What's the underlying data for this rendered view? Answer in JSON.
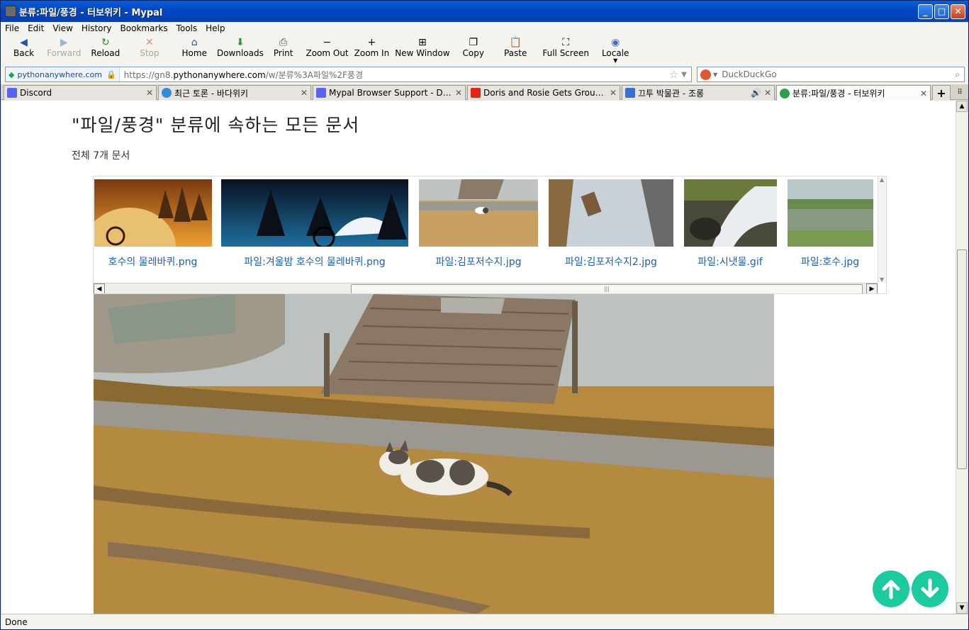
{
  "window": {
    "title": "분류:파일/풍경 - 터보위키 - Mypal"
  },
  "menu": [
    "File",
    "Edit",
    "View",
    "History",
    "Bookmarks",
    "Tools",
    "Help"
  ],
  "toolbar": [
    {
      "label": "Back",
      "icon": "back-arrow-icon",
      "enabled": true
    },
    {
      "label": "Forward",
      "icon": "forward-arrow-icon",
      "enabled": false
    },
    {
      "label": "Reload",
      "icon": "reload-icon",
      "enabled": true
    },
    {
      "label": "Stop",
      "icon": "stop-icon",
      "enabled": false
    },
    {
      "label": "Home",
      "icon": "home-icon",
      "enabled": true
    },
    {
      "label": "Downloads",
      "icon": "download-icon",
      "enabled": true
    },
    {
      "label": "Print",
      "icon": "printer-icon",
      "enabled": true
    },
    {
      "label": "Zoom Out",
      "icon": "minus-icon",
      "enabled": true
    },
    {
      "label": "Zoom In",
      "icon": "plus-icon",
      "enabled": true
    },
    {
      "label": "New Window",
      "icon": "new-window-icon",
      "enabled": true
    },
    {
      "label": "Copy",
      "icon": "copy-icon",
      "enabled": true
    },
    {
      "label": "Paste",
      "icon": "paste-icon",
      "enabled": true
    },
    {
      "label": "Full Screen",
      "icon": "fullscreen-icon",
      "enabled": true
    },
    {
      "label": "Locale",
      "icon": "globe-icon",
      "enabled": true
    }
  ],
  "address": {
    "site": "pythonanywhere.com",
    "url_prefix": "https://gn8.",
    "url_domain": "pythonanywhere.com",
    "url_path": "/w/분류%3A파일%2F풍경"
  },
  "search": {
    "placeholder": "DuckDuckGo"
  },
  "tabs": [
    {
      "title": "Discord",
      "color": "#5865f2",
      "active": false
    },
    {
      "title": "최근 토론 - 바다위키",
      "color": "#2a8fd8",
      "active": false
    },
    {
      "title": "Mypal Browser Support - Di…",
      "color": "#5865f2",
      "active": false
    },
    {
      "title": "Doris and Rosie Gets Groun…",
      "color": "#e62117",
      "active": false
    },
    {
      "title": "끄투 박물관 - 조롱",
      "color": "#3a6fd0",
      "active": false,
      "audio": true
    },
    {
      "title": "분류:파일/풍경 - 터보위키",
      "color": "#2aa04a",
      "active": true
    }
  ],
  "page": {
    "heading": "\"파일/풍경\" 분류에 속하는 모든 문서",
    "count": "전체 7개 문서",
    "gallery": [
      "호수의 물레바퀴.png",
      "파일:겨울밤 호수의 물레바퀴.png",
      "파일:김포저수지.jpg",
      "파일:김포저수지2.jpg",
      "파일:시냇물.gif",
      "파일:호수.jpg"
    ]
  },
  "status": "Done",
  "colors": {
    "accent": "#1ccaa0",
    "link": "#1b5fb3",
    "titlebar": "#0348c4"
  }
}
